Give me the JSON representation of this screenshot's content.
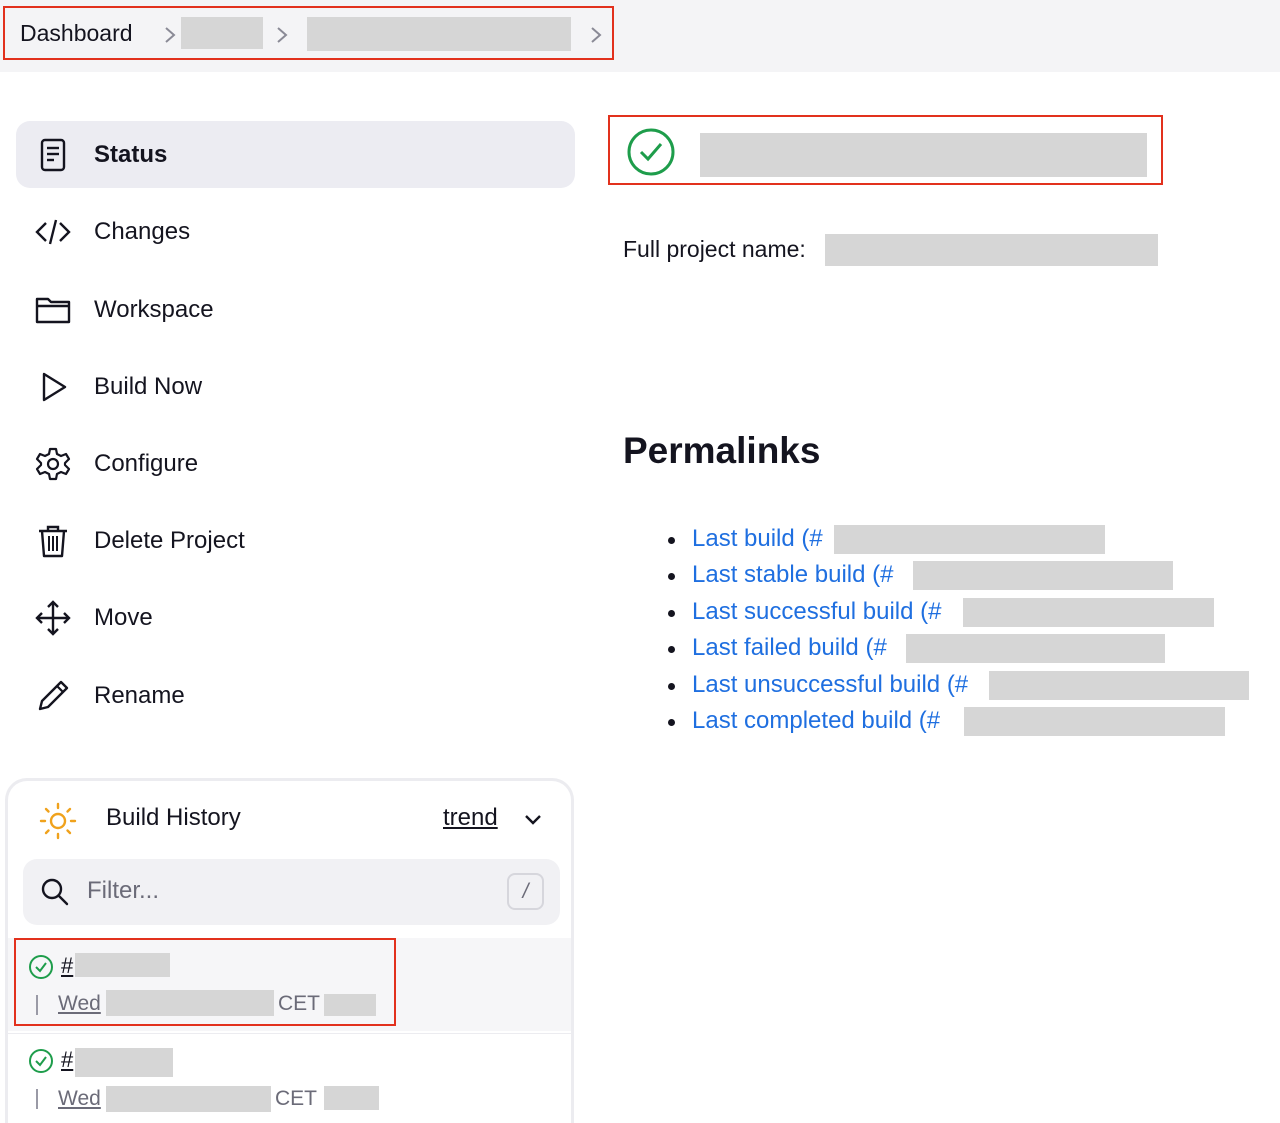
{
  "breadcrumb": {
    "root": "Dashboard"
  },
  "tasks": [
    {
      "label": "Status",
      "icon": "status-document-icon"
    },
    {
      "label": "Changes",
      "icon": "code-icon"
    },
    {
      "label": "Workspace",
      "icon": "folder-icon"
    },
    {
      "label": "Build Now",
      "icon": "play-icon"
    },
    {
      "label": "Configure",
      "icon": "gear-icon"
    },
    {
      "label": "Delete Project",
      "icon": "trash-icon"
    },
    {
      "label": "Move",
      "icon": "move-arrows-icon"
    },
    {
      "label": "Rename",
      "icon": "pencil-icon"
    }
  ],
  "build_history": {
    "title": "Build History",
    "trend": "trend",
    "filter_placeholder": "Filter...",
    "shortcut": "/",
    "builds": [
      {
        "number_prefix": "#",
        "day": "Wed",
        "tz": "CET"
      },
      {
        "number_prefix": "#",
        "day": "Wed",
        "tz": "CET"
      }
    ]
  },
  "main": {
    "full_project_name_label": "Full project name:",
    "permalinks_heading": "Permalinks",
    "permalinks": [
      "Last build (#",
      "Last stable build (#",
      "Last successful build (#",
      "Last failed build (#",
      "Last unsuccessful build (#",
      "Last completed build (#"
    ]
  },
  "colors": {
    "accent_link": "#1f6fe0",
    "success": "#1e9d4b",
    "highlight_border": "#e2311d"
  }
}
